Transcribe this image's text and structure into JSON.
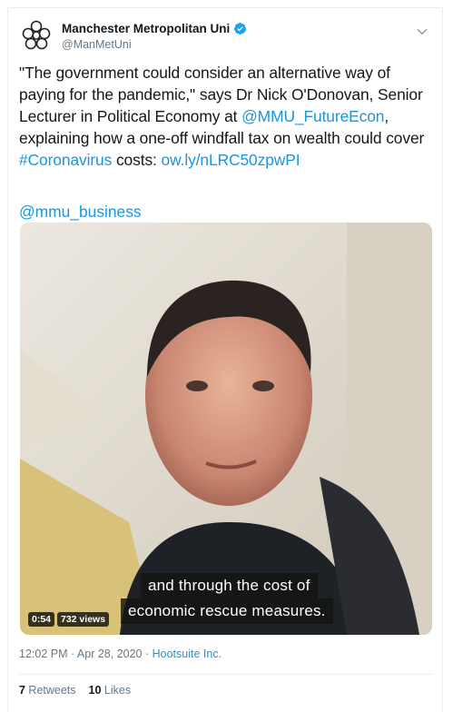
{
  "author": {
    "display_name": "Manchester Metropolitan Uni",
    "handle": "@ManMetUni",
    "verified": true,
    "logo_icon": "mmu-logo-icon"
  },
  "tweet": {
    "text_1": "\"The government could consider an alternative way of paying for the pandemic,\" says Dr Nick O'Donovan, Senior Lecturer in Political Economy at ",
    "mention_1": "@MMU_FutureEcon",
    "text_2": ", explaining how a one-off windfall tax on wealth could cover ",
    "hashtag": "#Coronavirus",
    "text_3": " costs: ",
    "link": "ow.ly/nLRC50zpwPI",
    "mention_2": "@mmu_business"
  },
  "video": {
    "subtitle_line_1": "and through the cost of",
    "subtitle_line_2": "economic rescue measures.",
    "duration": "0:54",
    "views": "732 views"
  },
  "meta": {
    "timestamp": "12:02 PM · Apr 28, 2020",
    "separator": " · ",
    "source": "Hootsuite Inc."
  },
  "stats": {
    "retweets_count": "7",
    "retweets_label": " Retweets",
    "likes_count": "10",
    "likes_label": " Likes"
  },
  "colors": {
    "link": "#1b95e0",
    "verified": "#1da1f2",
    "secondary_text": "#657786"
  }
}
